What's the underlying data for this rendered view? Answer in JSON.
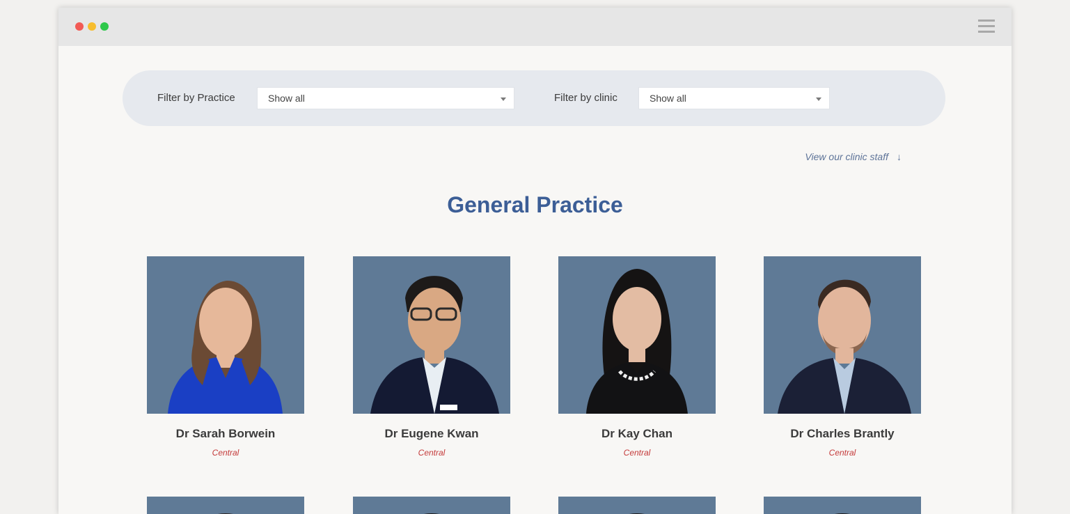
{
  "filters": {
    "practice_label": "Filter by Practice",
    "practice_value": "Show all",
    "clinic_label": "Filter by clinic",
    "clinic_value": "Show all"
  },
  "staff_link": {
    "label": "View our clinic staff",
    "icon": "arrow-down-icon"
  },
  "section": {
    "title": "General Practice"
  },
  "doctors": [
    {
      "name": "Dr Sarah Borwein",
      "location": "Central",
      "attire": "blue-dress",
      "hair": "long-brown"
    },
    {
      "name": "Dr Eugene Kwan",
      "location": "Central",
      "attire": "navy-suit",
      "hair": "short-dark"
    },
    {
      "name": "Dr Kay Chan",
      "location": "Central",
      "attire": "black-top",
      "hair": "long-dark"
    },
    {
      "name": "Dr Charles Brantly",
      "location": "Central",
      "attire": "navy-suit",
      "hair": "short-brown"
    }
  ],
  "colors": {
    "accent": "#3c5e96",
    "location": "#c43a3a",
    "photo_bg": "#5f7a96",
    "filter_bar": "#e6e9ee"
  }
}
